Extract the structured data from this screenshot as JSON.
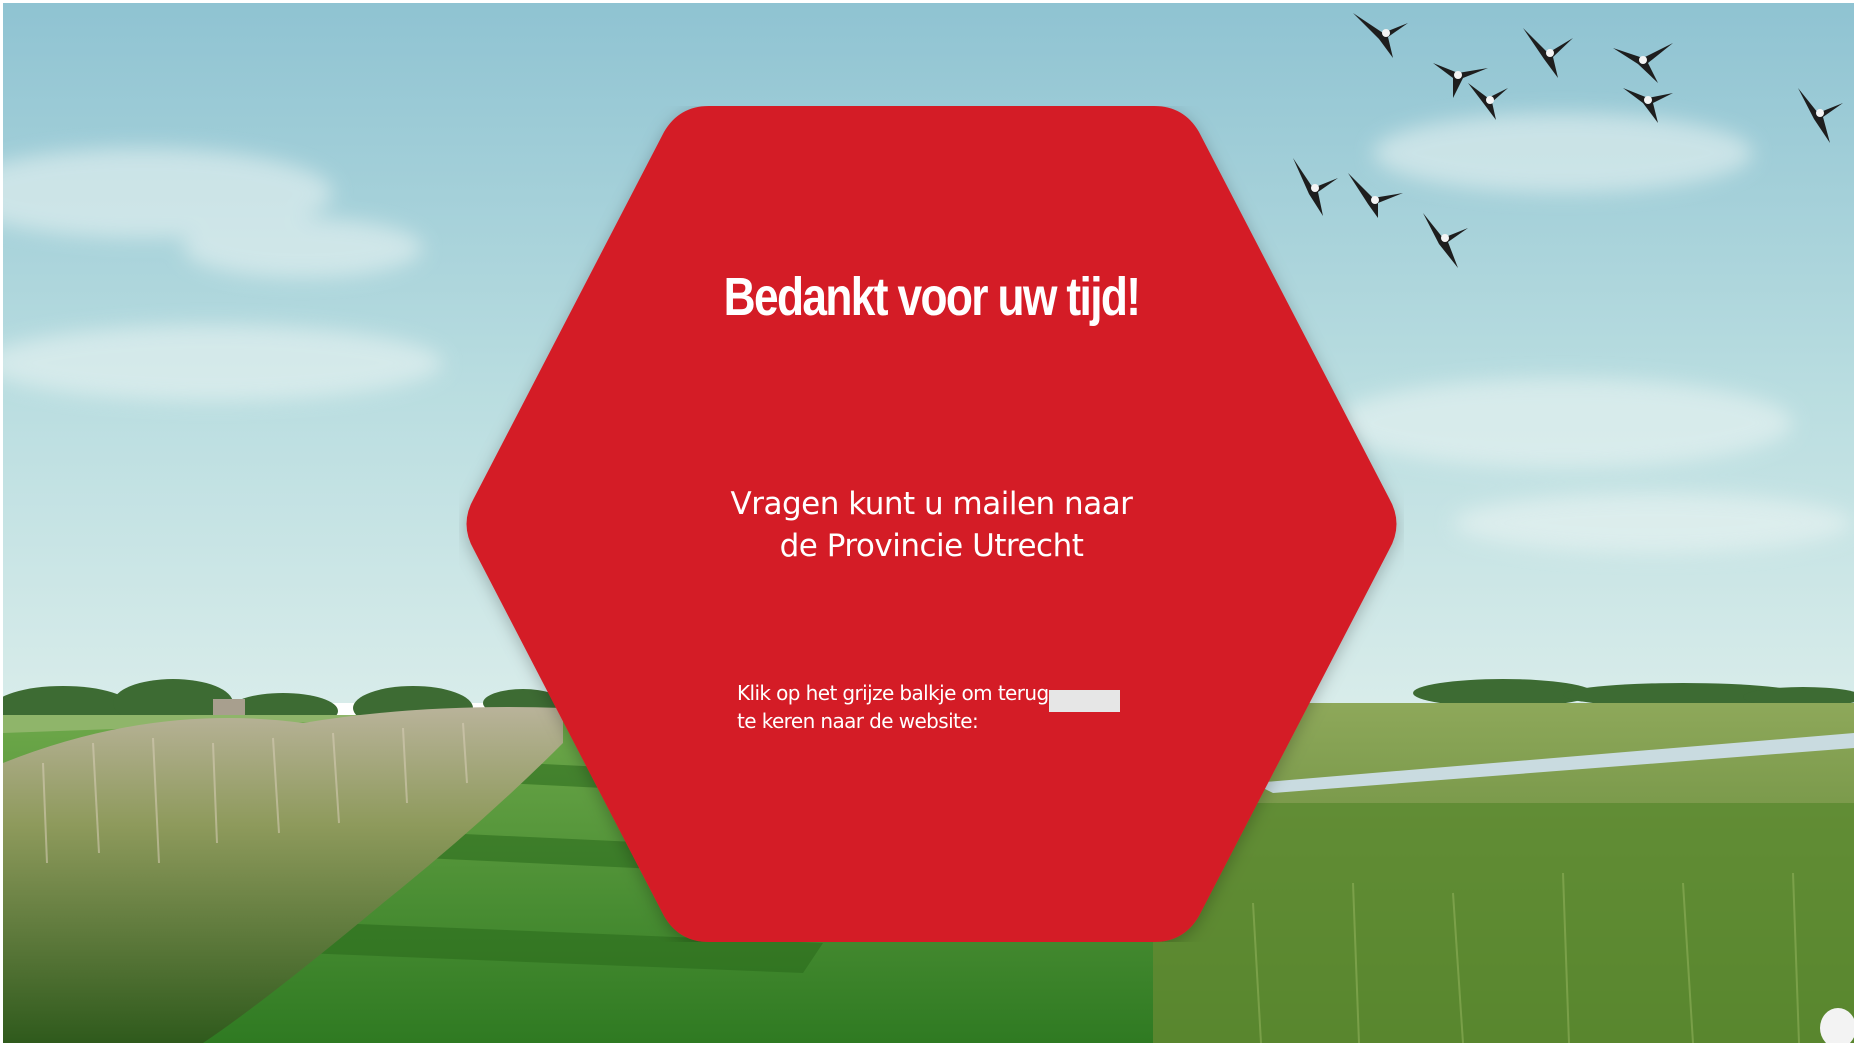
{
  "thank_you": {
    "title": "Bedankt voor uw tijd!",
    "contact_line_1": "Vragen kunt u mailen naar",
    "contact_line_2": "de Provincie Utrecht",
    "instruction_line_1": "Klik op het grijze balkje om terug",
    "instruction_line_2": "te keren naar de website:"
  },
  "colors": {
    "hexagon": "#d41f27",
    "sky_top": "#93c6d3",
    "sky_bottom": "#c9e5e6",
    "grass": "#3f8d2c",
    "grey_bar": "#e6e6e6"
  },
  "icons": {
    "birds": "flying-lapwing-flock-icon",
    "background": "polder-landscape-background"
  }
}
